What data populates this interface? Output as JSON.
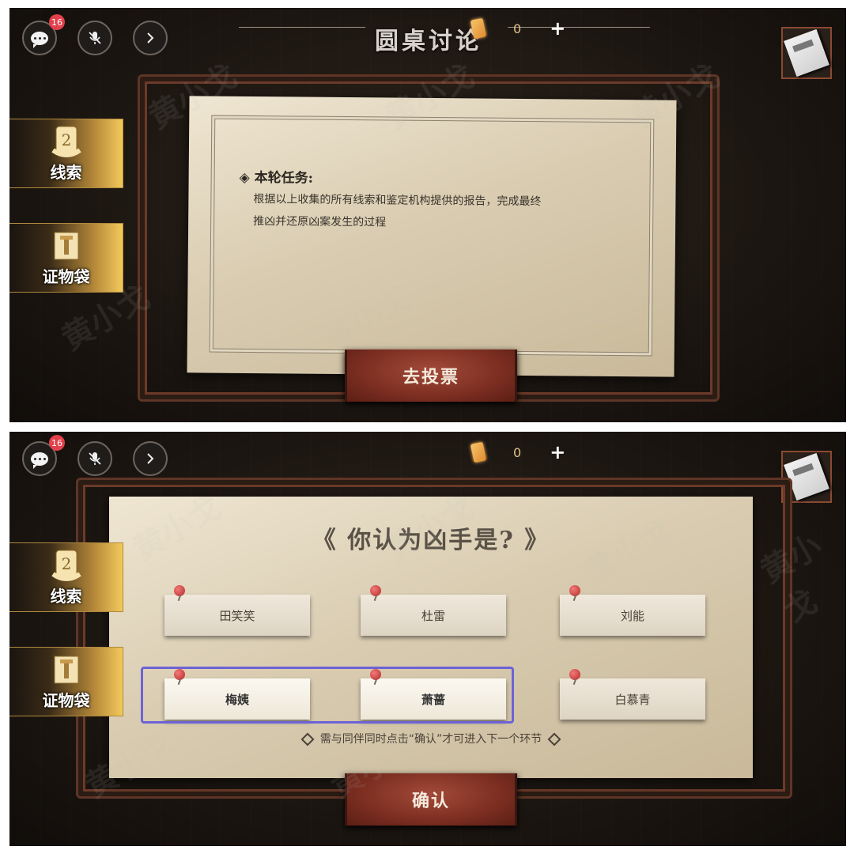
{
  "panel_top": {
    "chat_badge": "16",
    "title": "圆桌讨论",
    "currency_count": "0",
    "plus": "+",
    "side_tabs": [
      {
        "label": "线索",
        "icon": "scroll-icon"
      },
      {
        "label": "证物袋",
        "icon": "evidence-bag-icon"
      }
    ],
    "task_heading": "◈ 本轮任务:",
    "task_line1": "根据以上收集的所有线索和鉴定机构提供的报告，完成最终",
    "task_line2": "推凶并还原凶案发生的过程",
    "vote_button": "去投票"
  },
  "panel_bottom": {
    "chat_badge": "16",
    "currency_count": "0",
    "plus": "+",
    "side_tabs": [
      {
        "label": "线索",
        "icon": "scroll-icon"
      },
      {
        "label": "证物袋",
        "icon": "evidence-bag-icon"
      }
    ],
    "question": "《 你认为凶手是? 》",
    "suspects": [
      "田笑笑",
      "杜雷",
      "刘能",
      "梅姨",
      "萧蔷",
      "白慕青"
    ],
    "hint": "需与同伴同时点击“确认”才可进入下一个环节",
    "confirm_button": "确认"
  },
  "watermark": "黄小戈",
  "colors": {
    "highlight": "#6c63d6",
    "badge": "#e2404b",
    "button": "#7f3022",
    "tab_gold": "#f3c95b"
  }
}
